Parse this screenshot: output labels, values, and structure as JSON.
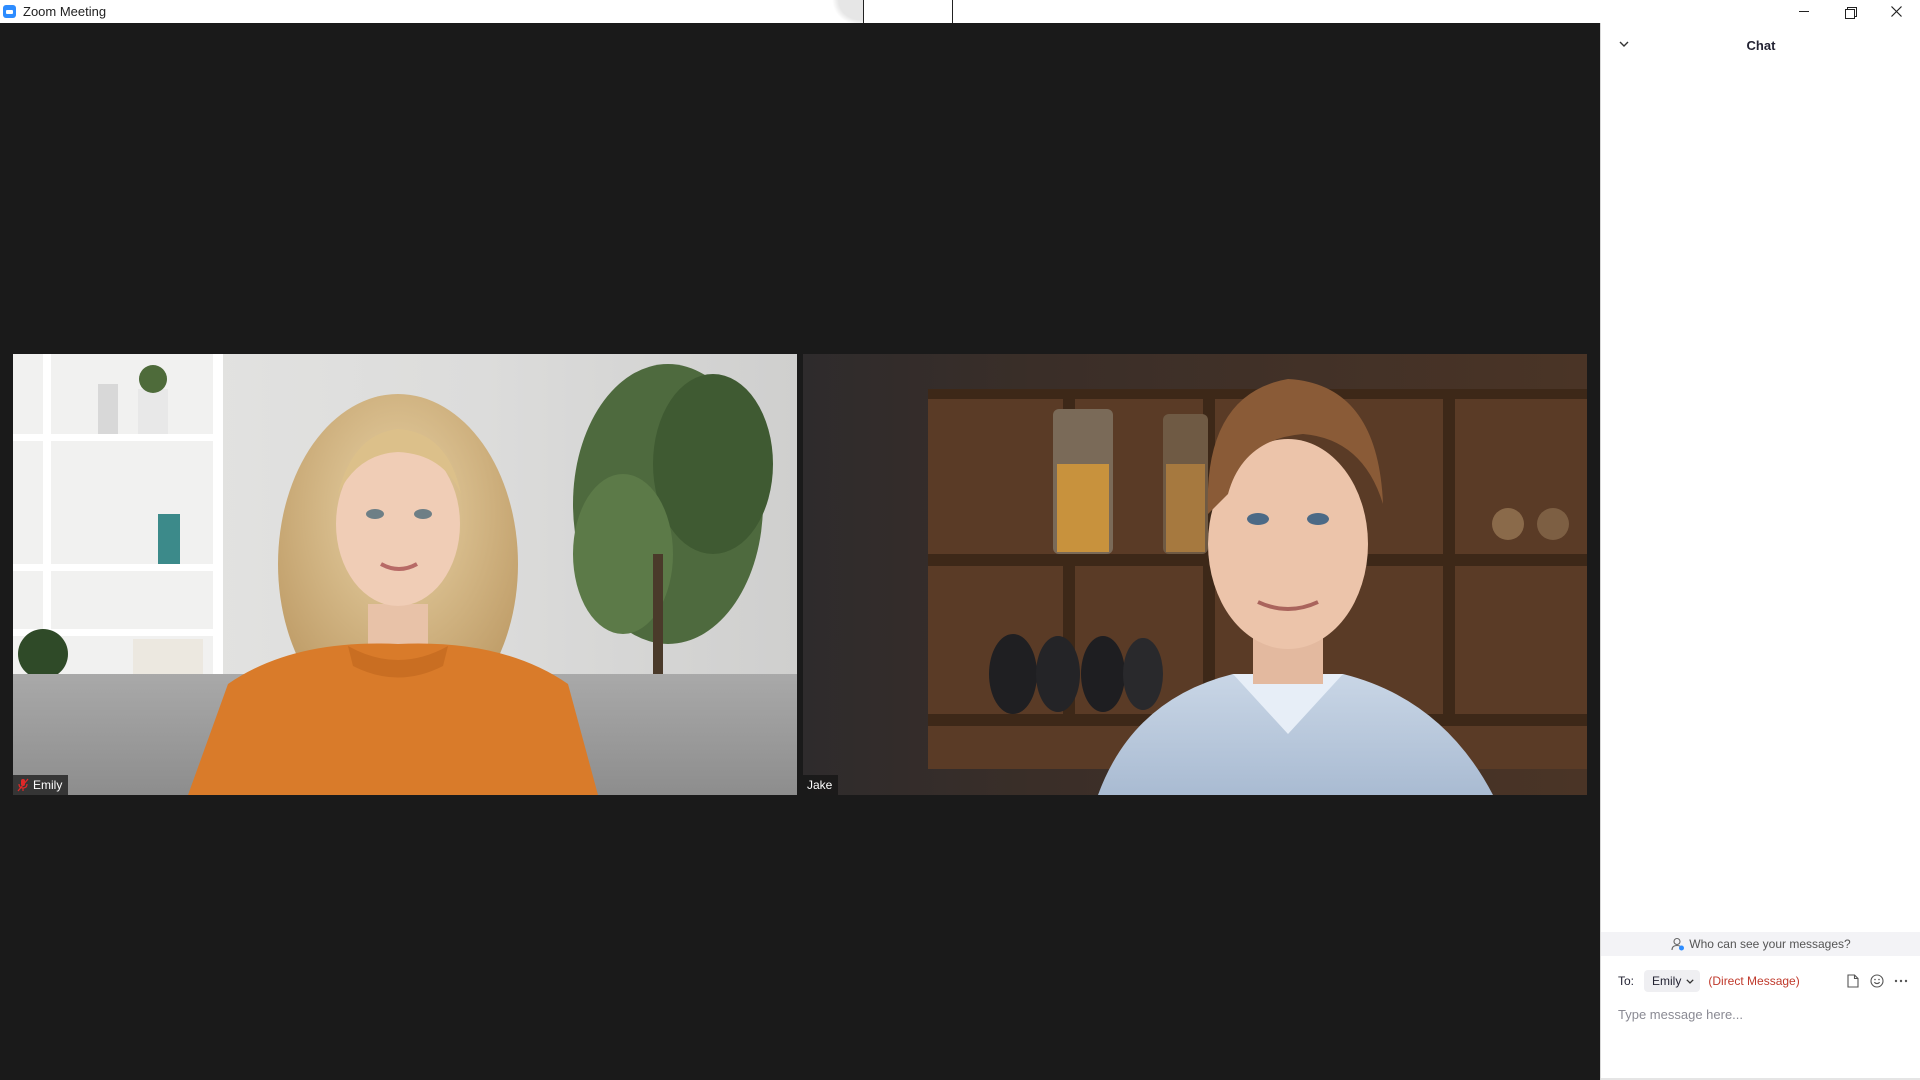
{
  "window": {
    "title": "Zoom Meeting"
  },
  "participants": [
    {
      "name": "Emily",
      "muted": true
    },
    {
      "name": "Jake",
      "muted": false
    }
  ],
  "chat": {
    "title": "Chat",
    "who_can_see": "Who can see your messages?",
    "to_label": "To:",
    "recipient": "Emily",
    "recipient_note": "(Direct Message)",
    "input_placeholder": "Type message here..."
  },
  "colors": {
    "stage_background": "#1a1a1a",
    "brand_blue": "#2d8cff",
    "direct_message_red": "#c0392b",
    "muted_icon_red": "#e02828"
  },
  "icons": {
    "app": "zoom-logo-icon",
    "minimize": "minimize-icon",
    "restore": "restore-icon",
    "close": "close-icon",
    "collapse": "chevron-down-icon",
    "privacy": "person-info-icon",
    "file": "file-icon",
    "emoji": "emoji-icon",
    "more": "more-icon",
    "muted": "mic-muted-icon"
  }
}
